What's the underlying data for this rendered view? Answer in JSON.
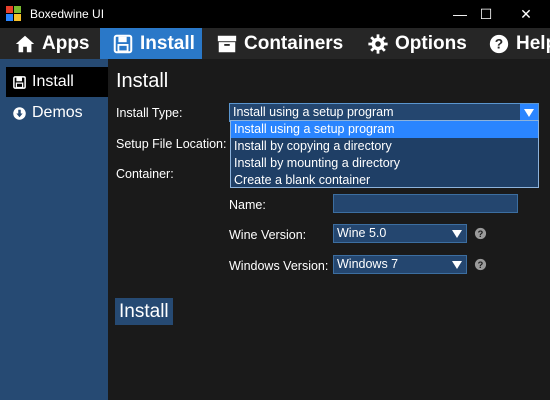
{
  "window": {
    "title": "Boxedwine UI",
    "controls": {
      "minimize": "—",
      "maximize": "☐",
      "close": "✕"
    }
  },
  "menu": {
    "items": [
      {
        "label": "Apps",
        "icon": "home-icon"
      },
      {
        "label": "Install",
        "icon": "floppy-icon",
        "active": true
      },
      {
        "label": "Containers",
        "icon": "box-icon"
      },
      {
        "label": "Options",
        "icon": "gear-icon"
      },
      {
        "label": "Help",
        "icon": "question-icon"
      }
    ]
  },
  "sidebar": {
    "items": [
      {
        "label": "Install",
        "icon": "floppy-icon",
        "active": true
      },
      {
        "label": "Demos",
        "icon": "download-circle-icon"
      }
    ]
  },
  "main": {
    "title": "Install",
    "install_type": {
      "label": "Install Type:",
      "value": "Install using a setup program",
      "options": [
        "Install using a setup program",
        "Install by copying a directory",
        "Install by mounting a directory",
        "Create a blank container"
      ],
      "selected_index": 0
    },
    "setup_file": {
      "label": "Setup File Location:"
    },
    "container": {
      "label": "Container:"
    },
    "name": {
      "label": "Name:",
      "value": ""
    },
    "wine_version": {
      "label": "Wine Version:",
      "value": "Wine 5.0"
    },
    "windows_version": {
      "label": "Windows Version:",
      "value": "Windows 7"
    },
    "install_button": "Install"
  },
  "colors": {
    "accent": "#2a78c8",
    "sidebar": "#264a73",
    "field": "#24466f",
    "highlight": "#2a85ff"
  }
}
